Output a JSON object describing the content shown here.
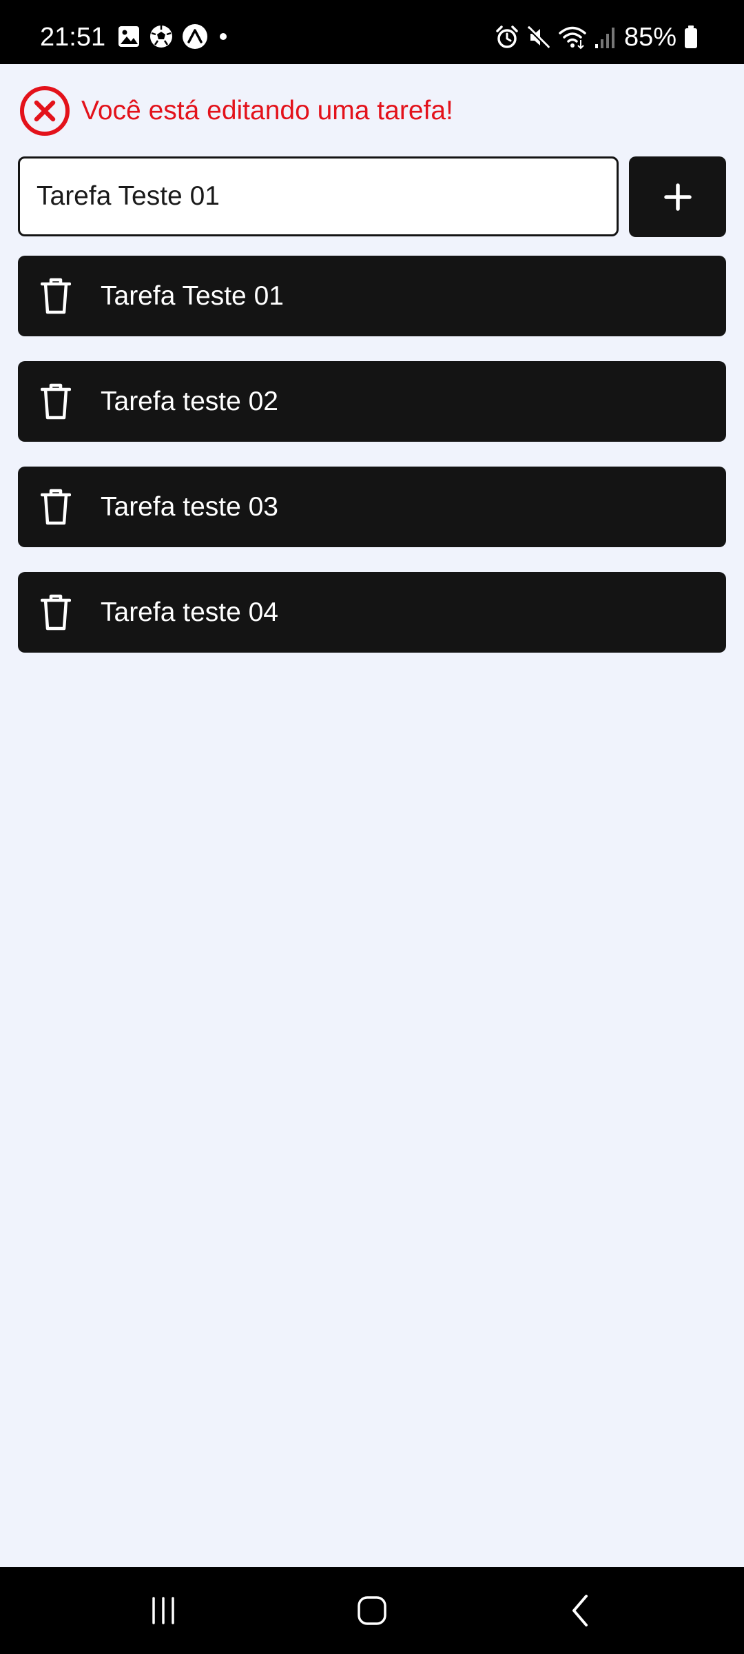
{
  "status_bar": {
    "time": "21:51",
    "battery_percent": "85%",
    "left_icons": [
      "gallery-icon",
      "soccer-ball-icon",
      "expo-icon",
      "dot-icon"
    ],
    "right_icons": [
      "alarm-icon",
      "mute-icon",
      "wifi-icon",
      "signal-icon",
      "battery-icon"
    ]
  },
  "editing_banner": {
    "message": "Você está editando uma tarefa!",
    "icon": "close-circle-icon",
    "color": "#e3121b"
  },
  "task_input": {
    "value": "Tarefa Teste 01"
  },
  "add_button": {
    "icon": "plus-icon",
    "label": "+"
  },
  "tasks": [
    {
      "label": "Tarefa Teste 01",
      "icon": "trash-icon"
    },
    {
      "label": "Tarefa teste 02",
      "icon": "trash-icon"
    },
    {
      "label": "Tarefa teste 03",
      "icon": "trash-icon"
    },
    {
      "label": "Tarefa teste 04",
      "icon": "trash-icon"
    }
  ],
  "nav_bar": {
    "buttons": [
      "recent-apps-icon",
      "home-icon",
      "back-icon"
    ]
  },
  "colors": {
    "background": "#f0f3fc",
    "item_background": "#141414",
    "accent_red": "#e3121b"
  }
}
